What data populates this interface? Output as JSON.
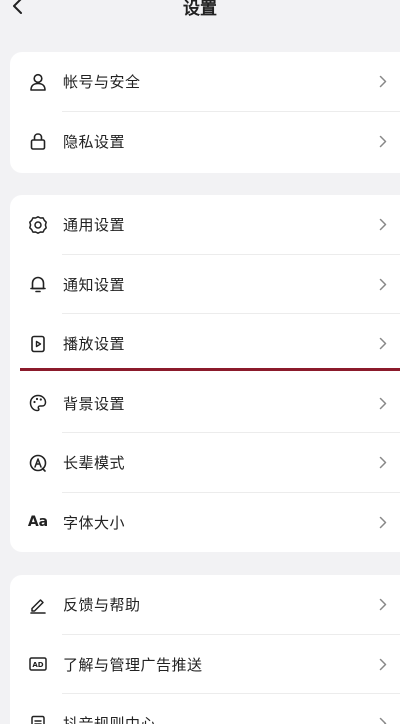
{
  "header": {
    "title": "设置",
    "back_icon": "chevron-left-icon"
  },
  "sections": [
    {
      "items": [
        {
          "label": "帐号与安全",
          "icon": "user-icon"
        },
        {
          "label": "隐私设置",
          "icon": "lock-icon"
        }
      ]
    },
    {
      "items": [
        {
          "label": "通用设置",
          "icon": "gear-icon"
        },
        {
          "label": "通知设置",
          "icon": "bell-icon"
        },
        {
          "label": "播放设置",
          "icon": "play-icon"
        },
        {
          "label": "背景设置",
          "icon": "palette-icon"
        },
        {
          "label": "长辈模式",
          "icon": "elder-mode-icon"
        },
        {
          "label": "字体大小",
          "icon": "font-size-icon",
          "icon_text": "Aa"
        }
      ]
    },
    {
      "items": [
        {
          "label": "反馈与帮助",
          "icon": "pen-icon"
        },
        {
          "label": "了解与管理广告推送",
          "icon": "ad-icon",
          "icon_text": "AD"
        },
        {
          "label": "抖音规则中心",
          "icon": "document-icon"
        }
      ]
    }
  ],
  "colors": {
    "background": "#f2f2f4",
    "card": "#ffffff",
    "highlight_line": "#8b1a2b"
  }
}
